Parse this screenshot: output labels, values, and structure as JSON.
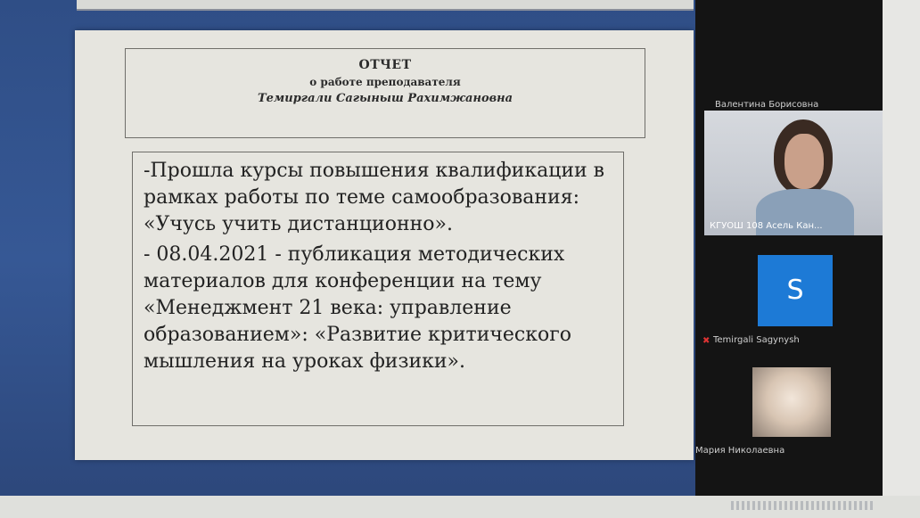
{
  "document": {
    "header": {
      "title": "ОТЧЕТ",
      "subtitle": "о работе преподавателя",
      "name": "Темиргали Сагыныш Рахимжановна"
    },
    "paragraphs": [
      "-Прошла курсы повышения квалификации в рамках работы по теме самообразования: «Учусь учить дистанционно».",
      "- 08.04.2021 - публикация методических материалов для конференции на тему «Менеджмент 21 века: управление образованием»: «Развитие критического мышления на уроках физики»."
    ]
  },
  "participants": [
    {
      "name": "Валентина Борисовна"
    },
    {
      "name": "КГУОШ 108 Асель Кан..."
    },
    {
      "name": "Temirgali Sagynysh",
      "avatar_letter": "S",
      "avatar_color": "#1d7ad6",
      "muted_icon": "mic-muted-icon"
    },
    {
      "name": "Мария Николаевна"
    }
  ]
}
